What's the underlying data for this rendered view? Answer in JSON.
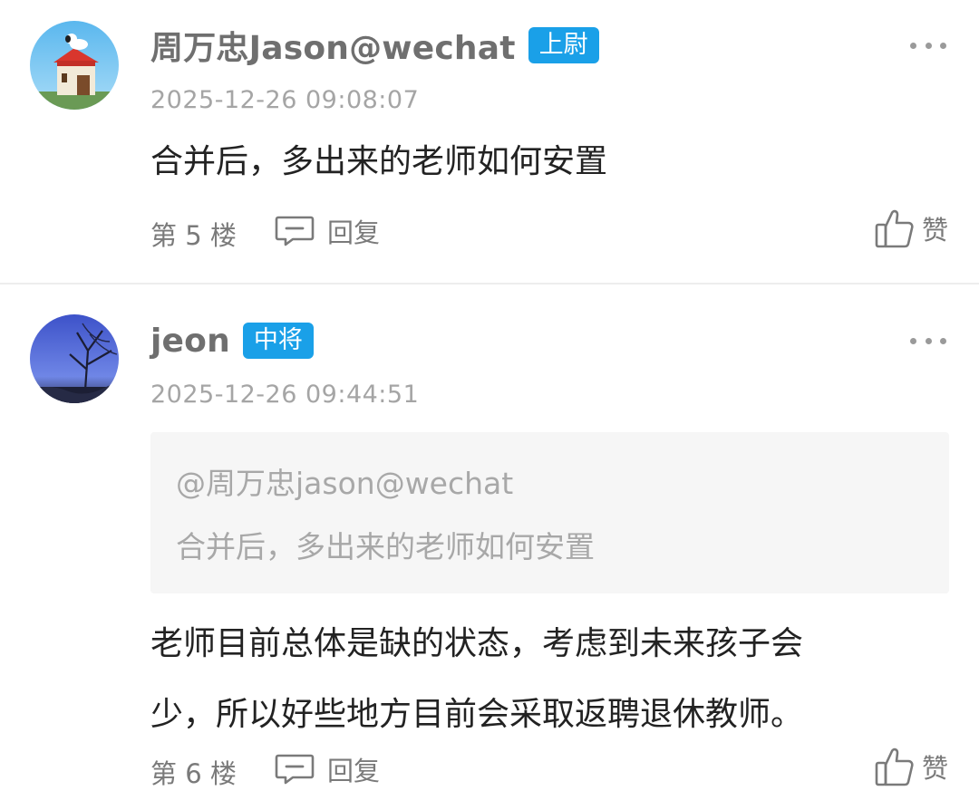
{
  "comments": [
    {
      "username": "周万忠Jason@wechat",
      "rank_badge": "上尉",
      "timestamp": "2025-12-26 09:08:07",
      "body": "合并后，多出来的老师如何安置",
      "floor": "第 5 楼",
      "reply_label": "回复",
      "like_label": "赞"
    },
    {
      "username": "jeon",
      "rank_badge": "中将",
      "timestamp": "2025-12-26 09:44:51",
      "quote": {
        "author": "@周万忠jason@wechat",
        "text": "合并后，多出来的老师如何安置"
      },
      "body_lines": [
        "老师目前总体是缺的状态，考虑到未来孩子会",
        "少，所以好些地方目前会采取返聘退休教师。"
      ],
      "floor": "第 6 楼",
      "reply_label": "回复",
      "like_label": "赞"
    }
  ],
  "icons": {
    "more": "more-dots-icon",
    "reply": "comment-bubble-icon",
    "like": "thumbs-up-icon"
  },
  "colors": {
    "badge": "#1aa0e8",
    "username": "#6f6f6f",
    "timestamp": "#a5a5a5",
    "body": "#222222",
    "quote_bg": "#f6f6f6",
    "quote_text": "#a8a8a8"
  }
}
